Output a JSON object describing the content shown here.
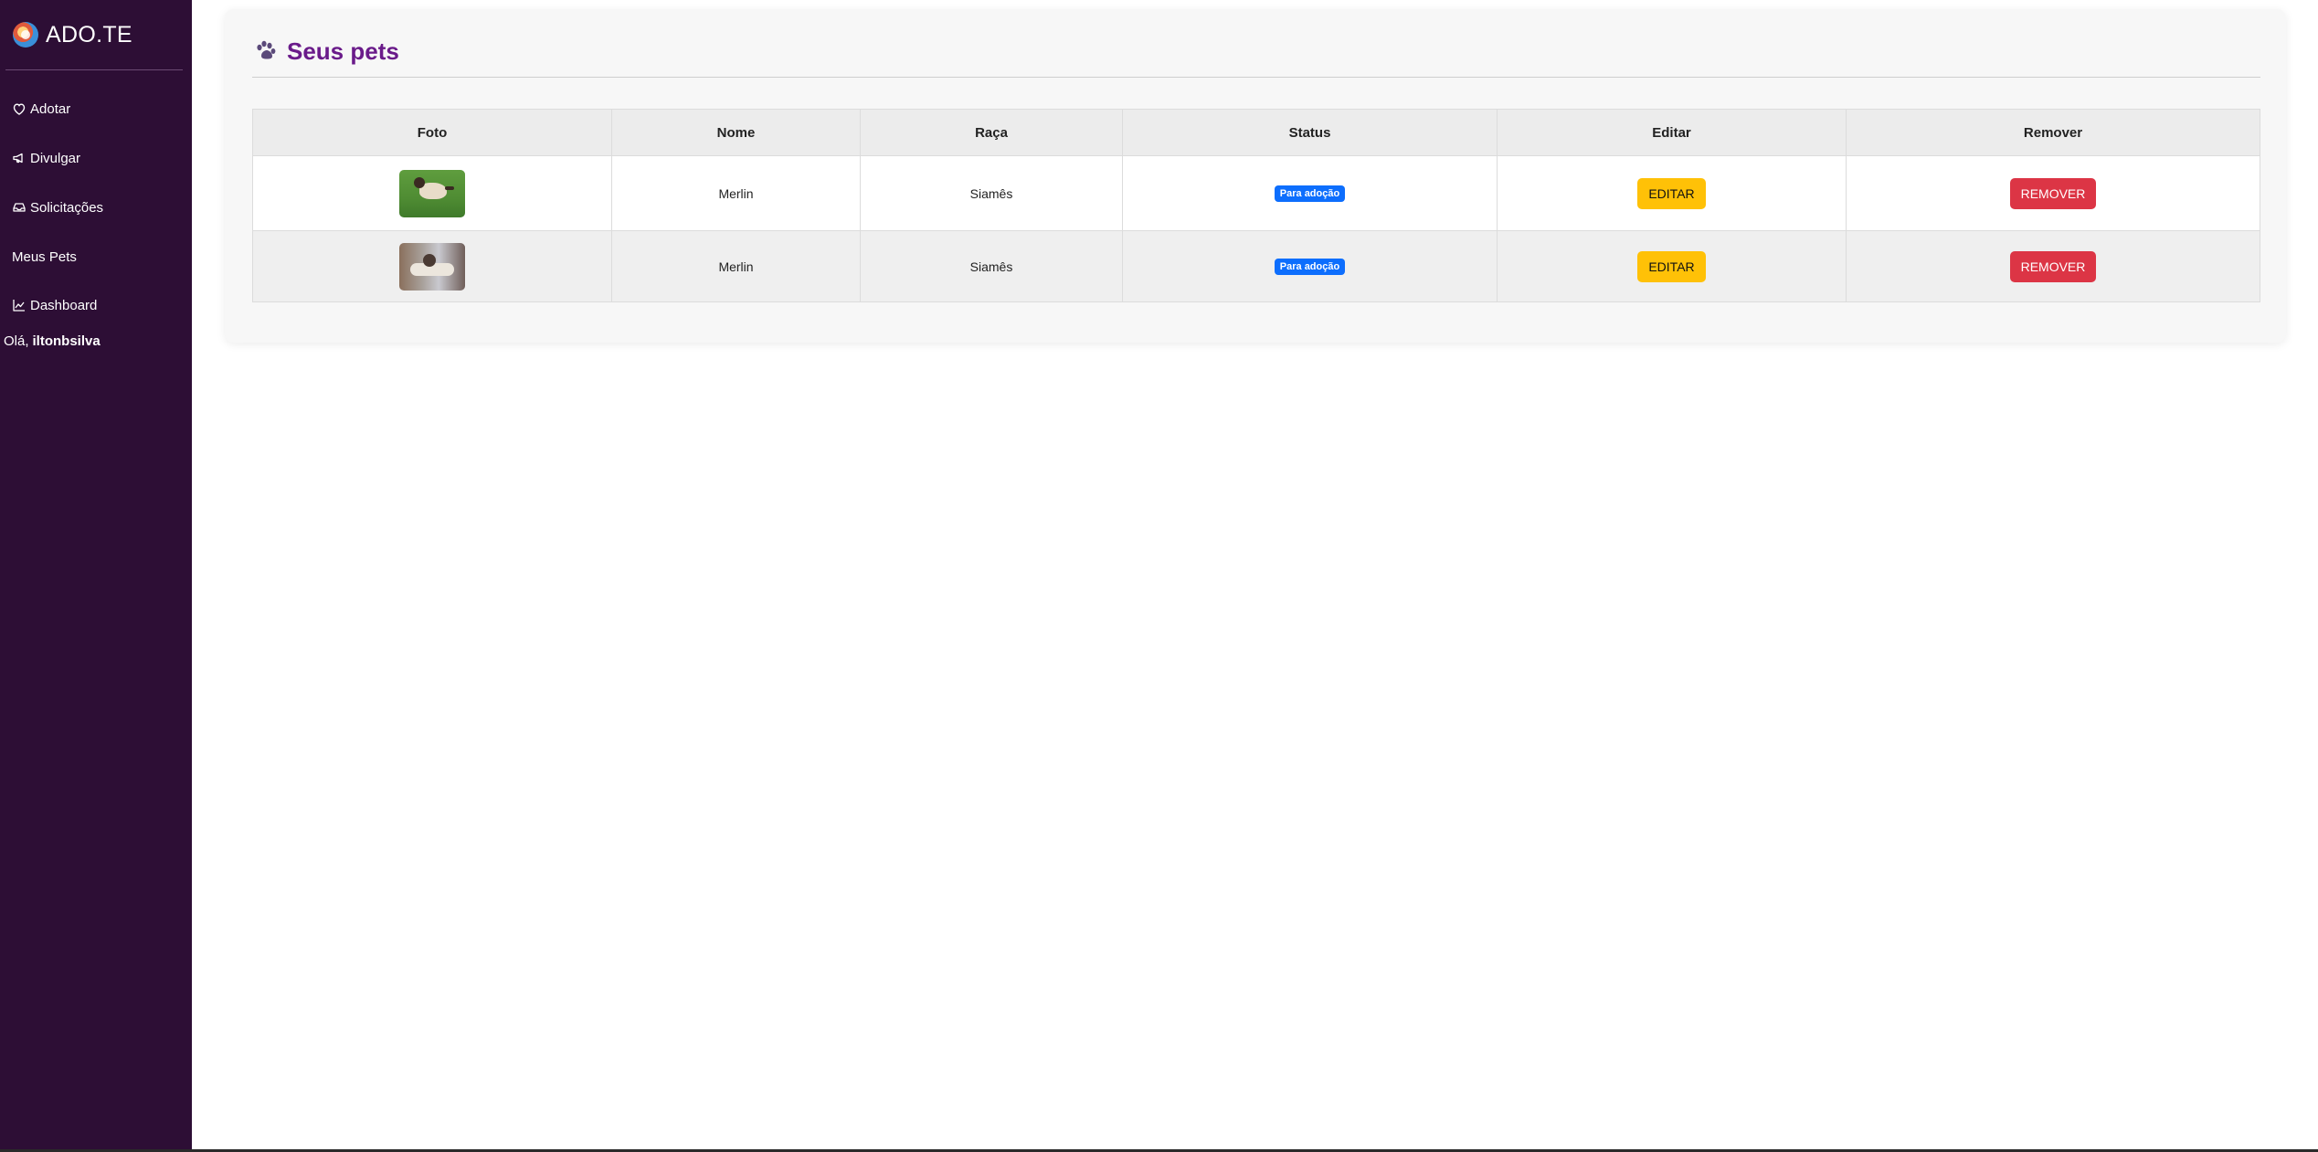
{
  "brand": {
    "name": "ADO.TE",
    "logo_icon": "dog-logo-icon"
  },
  "sidebar": {
    "items": [
      {
        "label": "Adotar",
        "icon": "heart-icon"
      },
      {
        "label": "Divulgar",
        "icon": "megaphone-icon"
      },
      {
        "label": "Solicitações",
        "icon": "inbox-icon"
      },
      {
        "label": "Meus Pets",
        "icon": ""
      },
      {
        "label": "Dashboard",
        "icon": "chart-line-icon"
      }
    ],
    "greeting_prefix": "Olá,",
    "username": "iltonbsilva"
  },
  "main": {
    "title": "Seus pets",
    "title_icon": "paw-icon",
    "accent_color": "#6a1b8a",
    "table": {
      "headers": [
        "Foto",
        "Nome",
        "Raça",
        "Status",
        "Editar",
        "Remover"
      ],
      "rows": [
        {
          "photo_alt": "cat-photo",
          "name": "Merlin",
          "breed": "Siamês",
          "status": "Para adoção",
          "edit_label": "EDITAR",
          "remove_label": "REMOVER"
        },
        {
          "photo_alt": "cat-photo",
          "name": "Merlin",
          "breed": "Siamês",
          "status": "Para adoção",
          "edit_label": "EDITAR",
          "remove_label": "REMOVER"
        }
      ]
    }
  },
  "colors": {
    "sidebar_bg": "#2d0e35",
    "badge": "#0d6efd",
    "edit_button": "#ffc107",
    "remove_button": "#dc3545"
  }
}
